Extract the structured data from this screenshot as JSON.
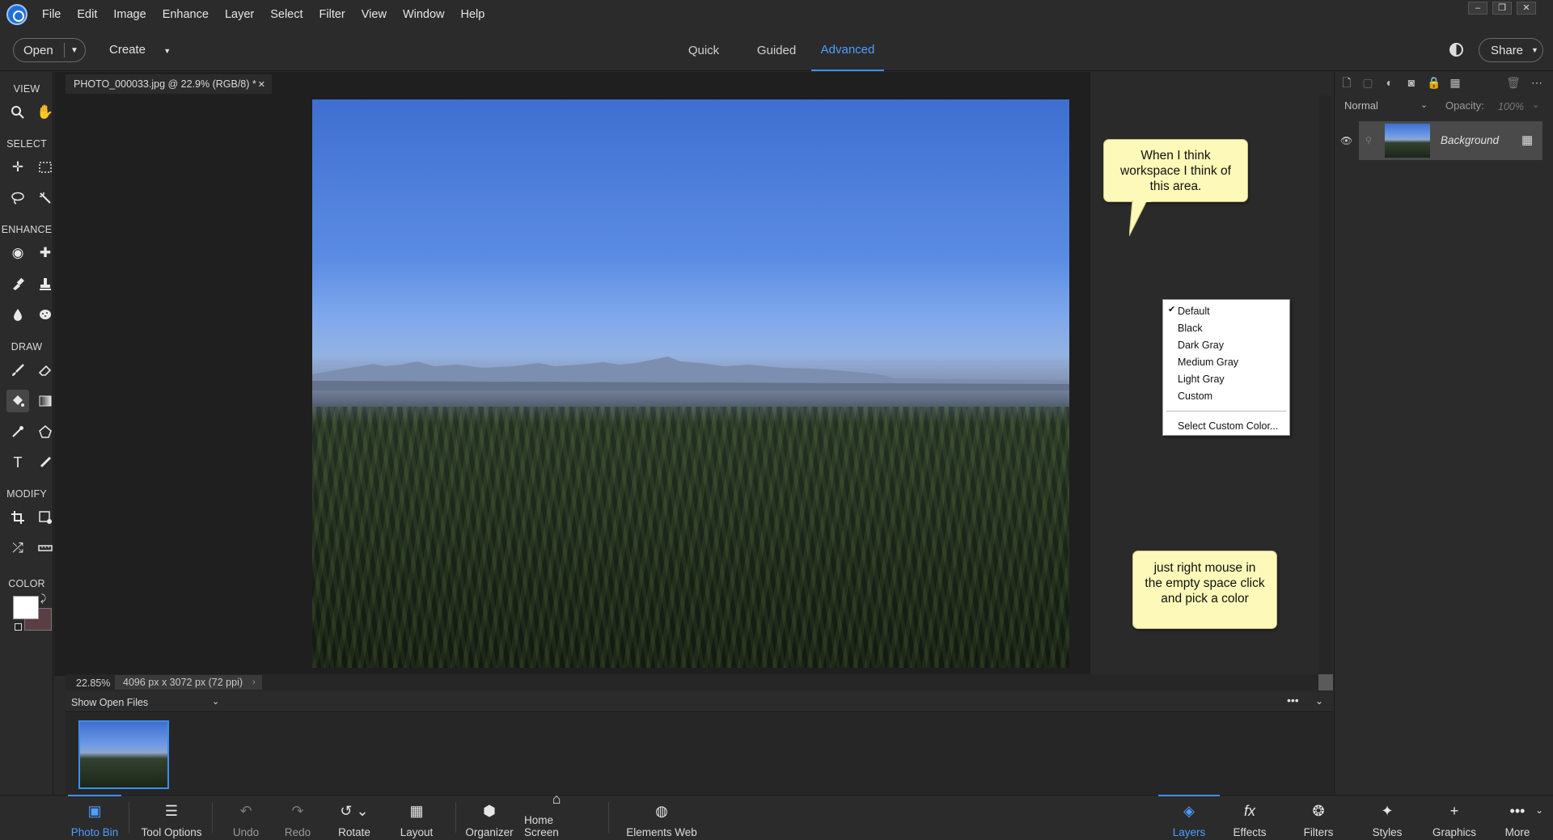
{
  "menubar": {
    "items": [
      "File",
      "Edit",
      "Image",
      "Enhance",
      "Layer",
      "Select",
      "Filter",
      "View",
      "Window",
      "Help"
    ]
  },
  "topbar": {
    "open_label": "Open",
    "create_label": "Create",
    "modes": [
      "Quick",
      "Guided",
      "Advanced"
    ],
    "active_mode": "Advanced",
    "share_label": "Share"
  },
  "toolbox": {
    "sections": [
      "VIEW",
      "SELECT",
      "ENHANCE",
      "DRAW",
      "MODIFY",
      "COLOR"
    ],
    "colors": {
      "foreground": "#ffffff",
      "background": "#5a3e44"
    }
  },
  "document": {
    "tab_title": "PHOTO_000033.jpg @ 22.9% (RGB/8) *",
    "zoom": "22.85%",
    "dimensions": "4096 px x 3072 px (72 ppi)"
  },
  "callouts": {
    "top": "When I think workspace I think of this area.",
    "bottom": "just right mouse in the empty space click and pick a color"
  },
  "context_menu": {
    "items": [
      "Default",
      "Black",
      "Dark Gray",
      "Medium Gray",
      "Light Gray",
      "Custom"
    ],
    "checked": "Default",
    "footer": "Select Custom Color..."
  },
  "photo_bin": {
    "dropdown_label": "Show Open Files"
  },
  "layers_panel": {
    "blend_mode": "Normal",
    "opacity_label": "Opacity:",
    "opacity_value": "100%",
    "layer_name": "Background"
  },
  "bottombar": {
    "left": [
      "Photo Bin",
      "Tool Options",
      "Undo",
      "Redo",
      "Rotate",
      "Layout",
      "Organizer",
      "Home Screen",
      "Elements Web"
    ],
    "right": [
      "Layers",
      "Effects",
      "Filters",
      "Styles",
      "Graphics",
      "More"
    ]
  },
  "colors": {
    "accent": "#3b8ef0",
    "callout_bg": "#fdf9b8"
  }
}
